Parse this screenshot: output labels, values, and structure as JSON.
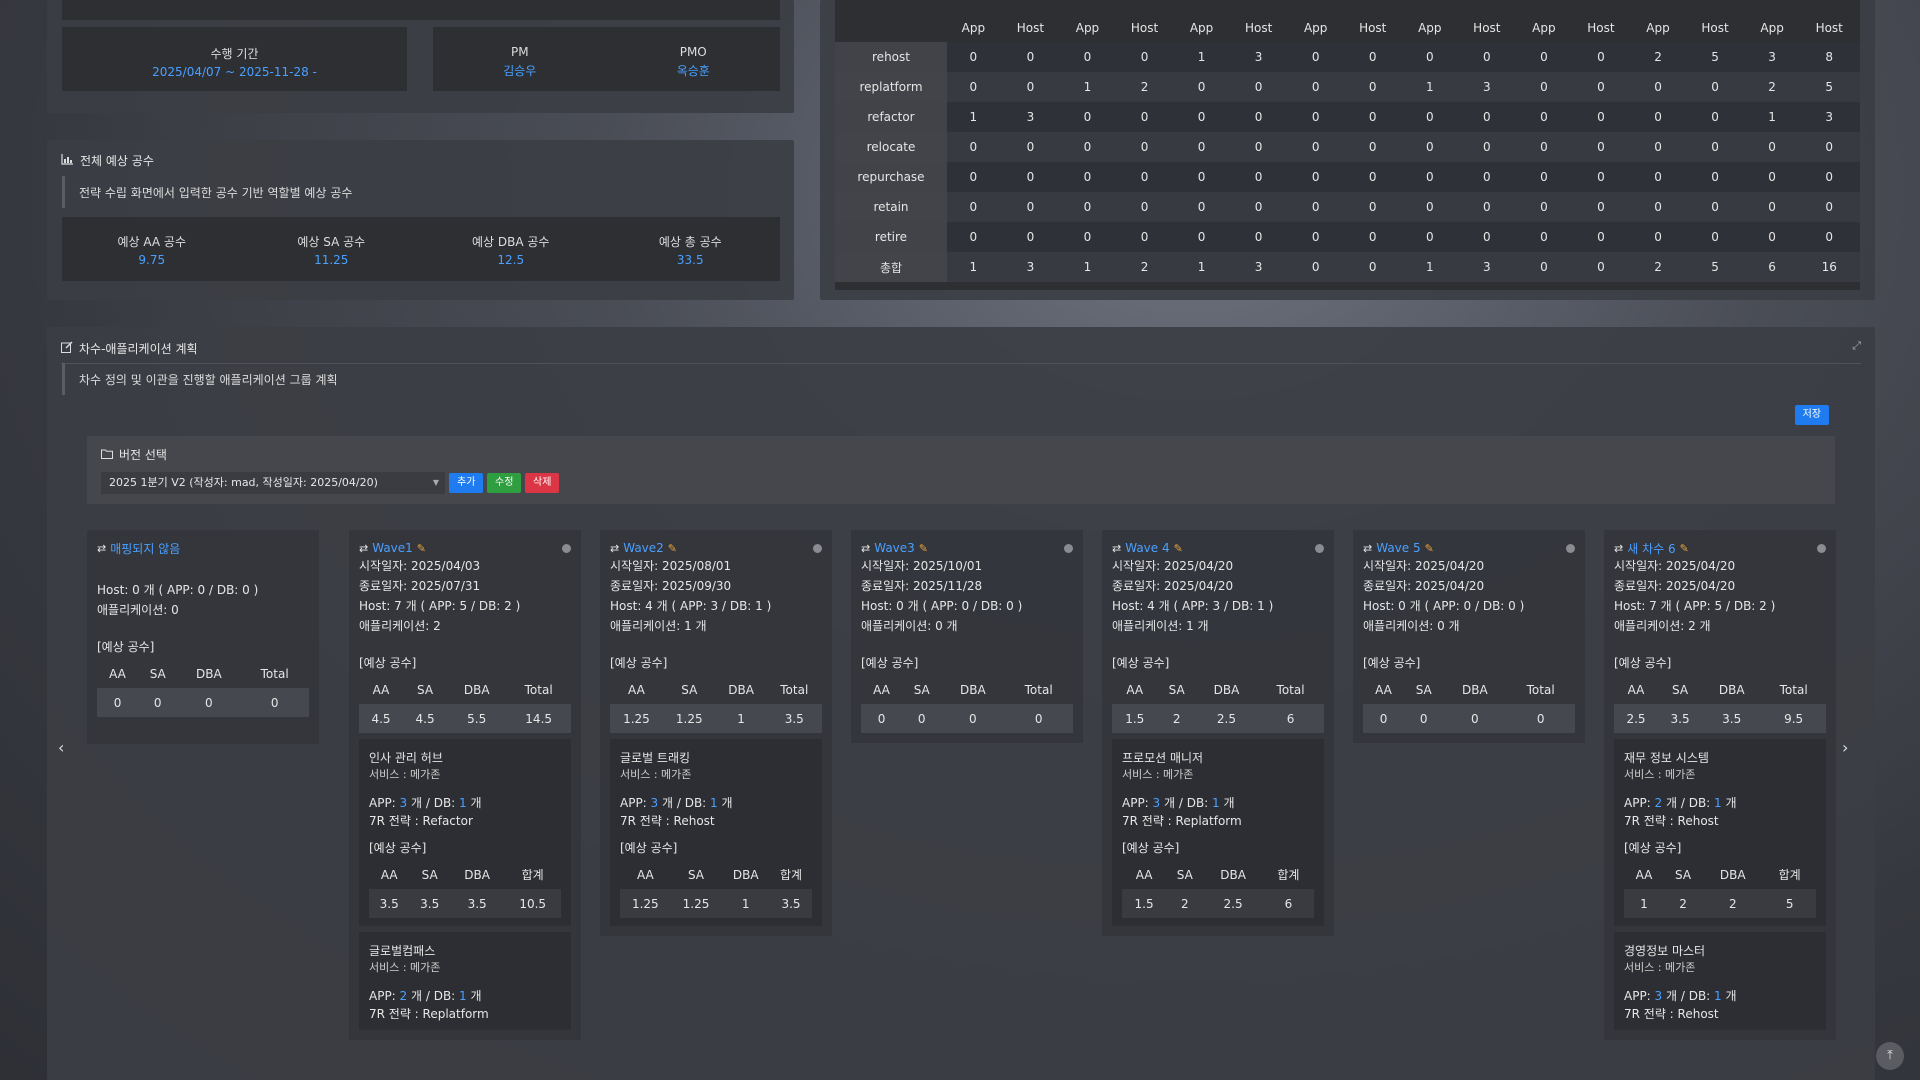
{
  "project": {
    "period_label": "수행 기간",
    "period_value": "2025/04/07 ~ 2025-11-28 -",
    "pm_label": "PM",
    "pm_value": "김승우",
    "pmo_label": "PMO",
    "pmo_value": "옥승훈"
  },
  "estimate_panel": {
    "title": "전체 예상 공수",
    "desc": "전략 수립 화면에서 입력한 공수 기반 역할별 예상 공수",
    "items": [
      {
        "label": "예상 AA 공수",
        "value": "9.75"
      },
      {
        "label": "예상 SA 공수",
        "value": "11.25"
      },
      {
        "label": "예상 DBA 공수",
        "value": "12.5"
      },
      {
        "label": "예상 총 공수",
        "value": "33.5"
      }
    ]
  },
  "r7_table": {
    "sub_headers": [
      "App",
      "Host",
      "App",
      "Host",
      "App",
      "Host",
      "App",
      "Host",
      "App",
      "Host",
      "App",
      "Host",
      "App",
      "Host",
      "App",
      "Host"
    ],
    "rows": [
      {
        "label": "rehost",
        "values": [
          "0",
          "0",
          "0",
          "0",
          "1",
          "3",
          "0",
          "0",
          "0",
          "0",
          "0",
          "0",
          "2",
          "5",
          "3",
          "8"
        ]
      },
      {
        "label": "replatform",
        "values": [
          "0",
          "0",
          "1",
          "2",
          "0",
          "0",
          "0",
          "0",
          "1",
          "3",
          "0",
          "0",
          "0",
          "0",
          "2",
          "5"
        ]
      },
      {
        "label": "refactor",
        "values": [
          "1",
          "3",
          "0",
          "0",
          "0",
          "0",
          "0",
          "0",
          "0",
          "0",
          "0",
          "0",
          "0",
          "0",
          "1",
          "3"
        ]
      },
      {
        "label": "relocate",
        "values": [
          "0",
          "0",
          "0",
          "0",
          "0",
          "0",
          "0",
          "0",
          "0",
          "0",
          "0",
          "0",
          "0",
          "0",
          "0",
          "0"
        ]
      },
      {
        "label": "repurchase",
        "values": [
          "0",
          "0",
          "0",
          "0",
          "0",
          "0",
          "0",
          "0",
          "0",
          "0",
          "0",
          "0",
          "0",
          "0",
          "0",
          "0"
        ]
      },
      {
        "label": "retain",
        "values": [
          "0",
          "0",
          "0",
          "0",
          "0",
          "0",
          "0",
          "0",
          "0",
          "0",
          "0",
          "0",
          "0",
          "0",
          "0",
          "0"
        ]
      },
      {
        "label": "retire",
        "values": [
          "0",
          "0",
          "0",
          "0",
          "0",
          "0",
          "0",
          "0",
          "0",
          "0",
          "0",
          "0",
          "0",
          "0",
          "0",
          "0"
        ]
      },
      {
        "label": "총합",
        "values": [
          "1",
          "3",
          "1",
          "2",
          "1",
          "3",
          "0",
          "0",
          "1",
          "3",
          "0",
          "0",
          "2",
          "5",
          "6",
          "16"
        ]
      }
    ]
  },
  "plan_panel": {
    "title": "차수-애플리케이션 계획",
    "desc": "차수 정의 및 이관을 진행할 애플리케이션 그룹 계획",
    "save_label": "저장",
    "version_title": "버전 선택",
    "version_selected": "2025 1분기 V2 (작성자: mad, 작성일자: 2025/04/20)",
    "add_label": "추가",
    "edit_label": "수정",
    "delete_label": "삭제"
  },
  "est_headers": [
    "AA",
    "SA",
    "DBA",
    "Total"
  ],
  "app_est_headers": [
    "AA",
    "SA",
    "DBA",
    "합계"
  ],
  "est_label": "[예상 공수]",
  "unmapped": {
    "title": "매핑되지 않음",
    "host": "Host: 0 개 ( APP: 0 / DB: 0 )",
    "apps": "애플리케이션: 0",
    "est": [
      "0",
      "0",
      "0",
      "0"
    ]
  },
  "waves": [
    {
      "title": "Wave1",
      "start": "시작일자: 2025/04/03",
      "end": "종료일자: 2025/07/31",
      "host": "Host: 7 개 ( APP: 5 / DB: 2 )",
      "apps": "애플리케이션: 2",
      "est": [
        "4.5",
        "4.5",
        "5.5",
        "14.5"
      ],
      "app_cards": [
        {
          "name": "인사 관리 허브",
          "svc": "서비스 : 메가존",
          "app_pre": "APP: ",
          "app_n": "3",
          "app_mid": " 개 / DB: ",
          "db_n": "1",
          "app_post": " 개",
          "strategy": "7R 전략 : Refactor",
          "est": [
            "3.5",
            "3.5",
            "3.5",
            "10.5"
          ]
        },
        {
          "name": "글로벌컴패스",
          "svc": "서비스 : 메가존",
          "app_pre": "APP: ",
          "app_n": "2",
          "app_mid": " 개 / DB: ",
          "db_n": "1",
          "app_post": " 개",
          "strategy": "7R 전략 : Replatform"
        }
      ]
    },
    {
      "title": "Wave2",
      "start": "시작일자: 2025/08/01",
      "end": "종료일자: 2025/09/30",
      "host": "Host: 4 개 ( APP: 3 / DB: 1 )",
      "apps": "애플리케이션: 1 개",
      "est": [
        "1.25",
        "1.25",
        "1",
        "3.5"
      ],
      "app_cards": [
        {
          "name": "글로벌 트래킹",
          "svc": "서비스 : 메가존",
          "app_pre": "APP: ",
          "app_n": "3",
          "app_mid": " 개 / DB: ",
          "db_n": "1",
          "app_post": " 개",
          "strategy": "7R 전략 : Rehost",
          "est": [
            "1.25",
            "1.25",
            "1",
            "3.5"
          ]
        }
      ]
    },
    {
      "title": "Wave3",
      "start": "시작일자: 2025/10/01",
      "end": "종료일자: 2025/11/28",
      "host": "Host: 0 개 ( APP: 0 / DB: 0 )",
      "apps": "애플리케이션: 0 개",
      "est": [
        "0",
        "0",
        "0",
        "0"
      ],
      "app_cards": []
    },
    {
      "title": "Wave 4",
      "start": "시작일자: 2025/04/20",
      "end": "종료일자: 2025/04/20",
      "host": "Host: 4 개 ( APP: 3 / DB: 1 )",
      "apps": "애플리케이션: 1 개",
      "est": [
        "1.5",
        "2",
        "2.5",
        "6"
      ],
      "app_cards": [
        {
          "name": "프로모션 매니저",
          "svc": "서비스 : 메가존",
          "app_pre": "APP: ",
          "app_n": "3",
          "app_mid": " 개 / DB: ",
          "db_n": "1",
          "app_post": " 개",
          "strategy": "7R 전략 : Replatform",
          "est": [
            "1.5",
            "2",
            "2.5",
            "6"
          ]
        }
      ]
    },
    {
      "title": "Wave 5",
      "start": "시작일자: 2025/04/20",
      "end": "종료일자: 2025/04/20",
      "host": "Host: 0 개 ( APP: 0 / DB: 0 )",
      "apps": "애플리케이션: 0 개",
      "est": [
        "0",
        "0",
        "0",
        "0"
      ],
      "app_cards": []
    },
    {
      "title": "새 차수 6",
      "start": "시작일자: 2025/04/20",
      "end": "종료일자: 2025/04/20",
      "host": "Host: 7 개 ( APP: 5 / DB: 2 )",
      "apps": "애플리케이션: 2 개",
      "est": [
        "2.5",
        "3.5",
        "3.5",
        "9.5"
      ],
      "app_cards": [
        {
          "name": "재무 정보 시스템",
          "svc": "서비스 : 메가존",
          "app_pre": "APP: ",
          "app_n": "2",
          "app_mid": " 개 / DB: ",
          "db_n": "1",
          "app_post": " 개",
          "strategy": "7R 전략 : Rehost",
          "est": [
            "1",
            "2",
            "2",
            "5"
          ]
        },
        {
          "name": "경영정보 마스터",
          "svc": "서비스 : 메가존",
          "app_pre": "APP: ",
          "app_n": "3",
          "app_mid": " 개 / DB: ",
          "db_n": "1",
          "app_post": " 개",
          "strategy": "7R 전략 : Rehost"
        }
      ]
    }
  ],
  "colors": {
    "accent": "#4aa0ff",
    "add": "#1e7bf0",
    "edit": "#2f9e41",
    "delete": "#dc3545",
    "pencil": "#e8a33a"
  }
}
